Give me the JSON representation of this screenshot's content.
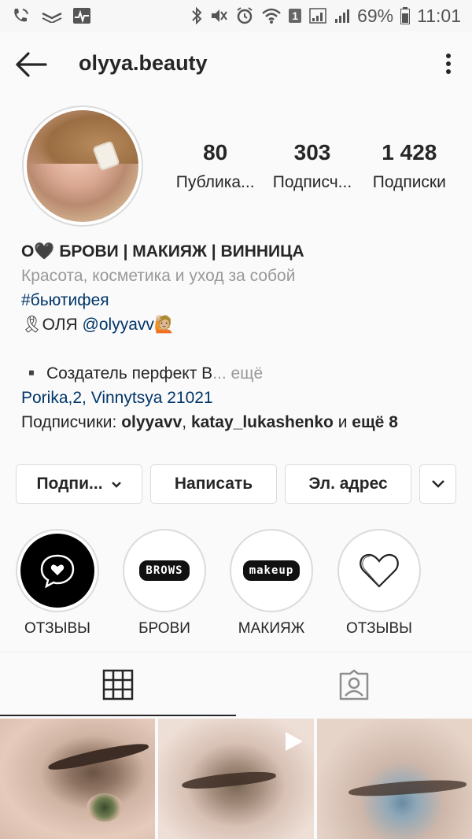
{
  "status_bar": {
    "battery": "69%",
    "time": "11:01",
    "sim_badge": "1"
  },
  "header": {
    "username": "olyya.beauty"
  },
  "stats": [
    {
      "value": "80",
      "label": "Публика..."
    },
    {
      "value": "303",
      "label": "Подписч..."
    },
    {
      "value": "1 428",
      "label": "Подписки"
    }
  ],
  "bio": {
    "name": "О🖤 БРОВИ | МАКИЯЖ | ВИННИЦА",
    "category": "Красота, косметика и уход за собой",
    "hashtag": "#бьютифея",
    "line_prefix": "🎗ОЛЯ ",
    "mention": "@olyyavv",
    "line_suffix": "🙋🏼",
    "bullet_text": "▪️ Создатель перфект В",
    "more_text": "... ещё",
    "address": "Porika,2, Vinnytsya 21021",
    "followers_prefix": "Подписчики: ",
    "follower_1": "olyyavv",
    "sep": ", ",
    "follower_2": "katay_lukashenko",
    "and_text": " и ",
    "more_followers": "ещё 8"
  },
  "buttons": {
    "subscribe": "Подпи...",
    "message": "Написать",
    "email": "Эл. адрес"
  },
  "highlights": [
    {
      "label": "ОТЗЫВЫ",
      "icon": "chat-heart-icon"
    },
    {
      "label": "БРОВИ",
      "icon": "brows-text",
      "pill": "BROWS"
    },
    {
      "label": "МАКИЯЖ",
      "icon": "makeup-text",
      "pill": "makeup"
    },
    {
      "label": "ОТЗЫВЫ",
      "icon": "heart-icon"
    }
  ],
  "tabs": [
    {
      "name": "grid-icon",
      "active": true
    },
    {
      "name": "tagged-icon",
      "active": false
    }
  ],
  "colors": {
    "link": "#003569",
    "muted": "#999999",
    "text": "#262626",
    "border": "#dbdbdb"
  }
}
